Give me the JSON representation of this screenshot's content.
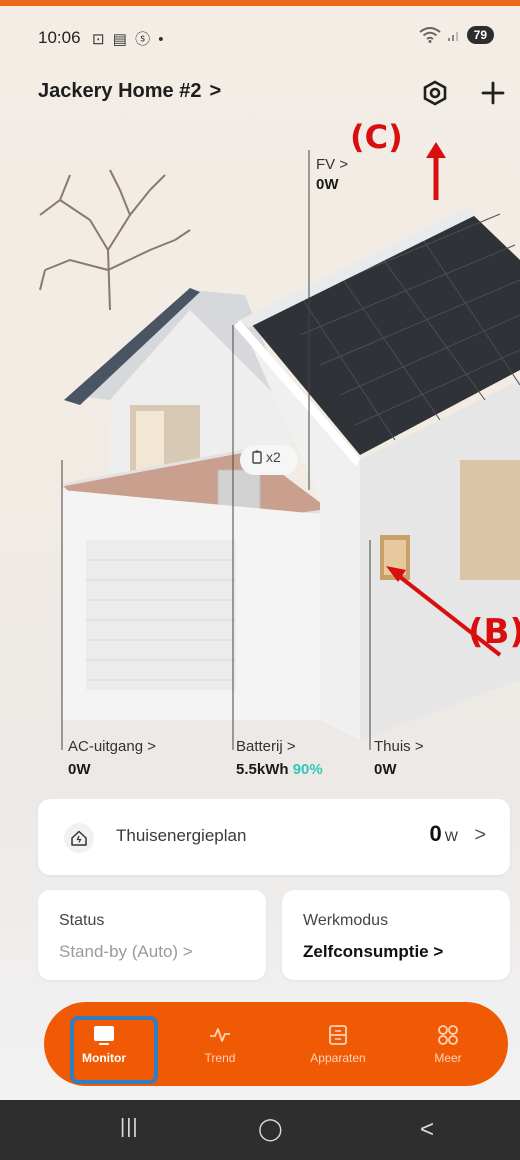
{
  "status_bar": {
    "time": "10:06",
    "left_icons": "⊡ ▤ ⓢ •",
    "battery": "79"
  },
  "header": {
    "title": "Jackery Home #2",
    "title_chevron": ">",
    "settings_icon": "gear-hex-icon",
    "add_icon": "plus-icon"
  },
  "annotations": {
    "c": "(C)",
    "b": "(B)"
  },
  "scene": {
    "battery_count": "x2",
    "pv": {
      "label": "FV >",
      "value": "0W"
    },
    "ac_output": {
      "label": "AC-uitgang >",
      "value": "0W"
    },
    "battery": {
      "label": "Batterij >",
      "value": "5.5kWh",
      "percent": "90%"
    },
    "home": {
      "label": "Thuis >",
      "value": "0W"
    }
  },
  "energy_plan": {
    "label": "Thuisenergieplan",
    "value": "0",
    "unit": "W",
    "chevron": ">"
  },
  "status": {
    "title": "Status",
    "value": "Stand-by (Auto) >"
  },
  "work_mode": {
    "title": "Werkmodus",
    "value": "Zelfconsumptie >"
  },
  "bottom_nav": {
    "items": [
      {
        "label": "Monitor",
        "icon": "monitor-icon",
        "active": true
      },
      {
        "label": "Trend",
        "icon": "trend-icon",
        "active": false
      },
      {
        "label": "Apparaten",
        "icon": "devices-icon",
        "active": false
      },
      {
        "label": "Meer",
        "icon": "more-icon",
        "active": false
      }
    ]
  },
  "system_nav": {
    "recents": "|||",
    "home": "◯",
    "back": "<"
  },
  "colors": {
    "accent": "#f15a05",
    "percent": "#34c6b8",
    "annotation": "#d90f0f",
    "highlight": "#2f7ec1"
  }
}
